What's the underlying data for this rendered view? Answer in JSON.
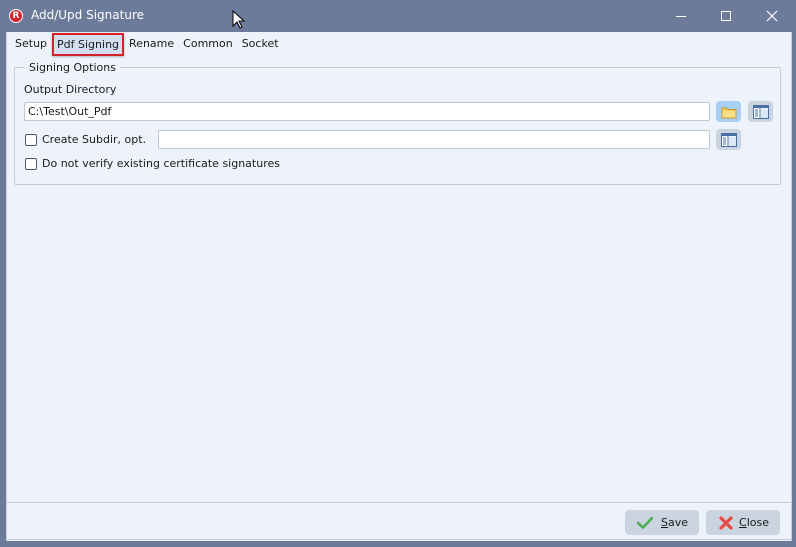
{
  "window": {
    "title": "Add/Upd Signature",
    "app_icon_letter": "R",
    "controls": [
      "minimize",
      "maximize",
      "close"
    ]
  },
  "tabs": [
    {
      "label": "Setup",
      "active": false
    },
    {
      "label": "Pdf Signing",
      "active": true
    },
    {
      "label": "Rename",
      "active": false
    },
    {
      "label": "Common",
      "active": false
    },
    {
      "label": "Socket",
      "active": false
    }
  ],
  "signing_options": {
    "legend": "Signing Options",
    "output_directory_label": "Output Directory",
    "output_directory_value": "C:\\Test\\Out_Pdf",
    "create_subdir_label": "Create Subdir, opt.",
    "create_subdir_checked": false,
    "create_subdir_value": "",
    "no_verify_label": "Do not verify existing certificate signatures",
    "no_verify_checked": false
  },
  "footer": {
    "save_mnemonic": "S",
    "save_rest": "ave",
    "close_mnemonic": "C",
    "close_rest": "lose"
  },
  "colors": {
    "titlebar": "#6b7b99",
    "body": "#eef3fb",
    "active_tab_border": "#d4242a",
    "button": "#cad4e0",
    "button_highlight": "#a8d0f7"
  }
}
